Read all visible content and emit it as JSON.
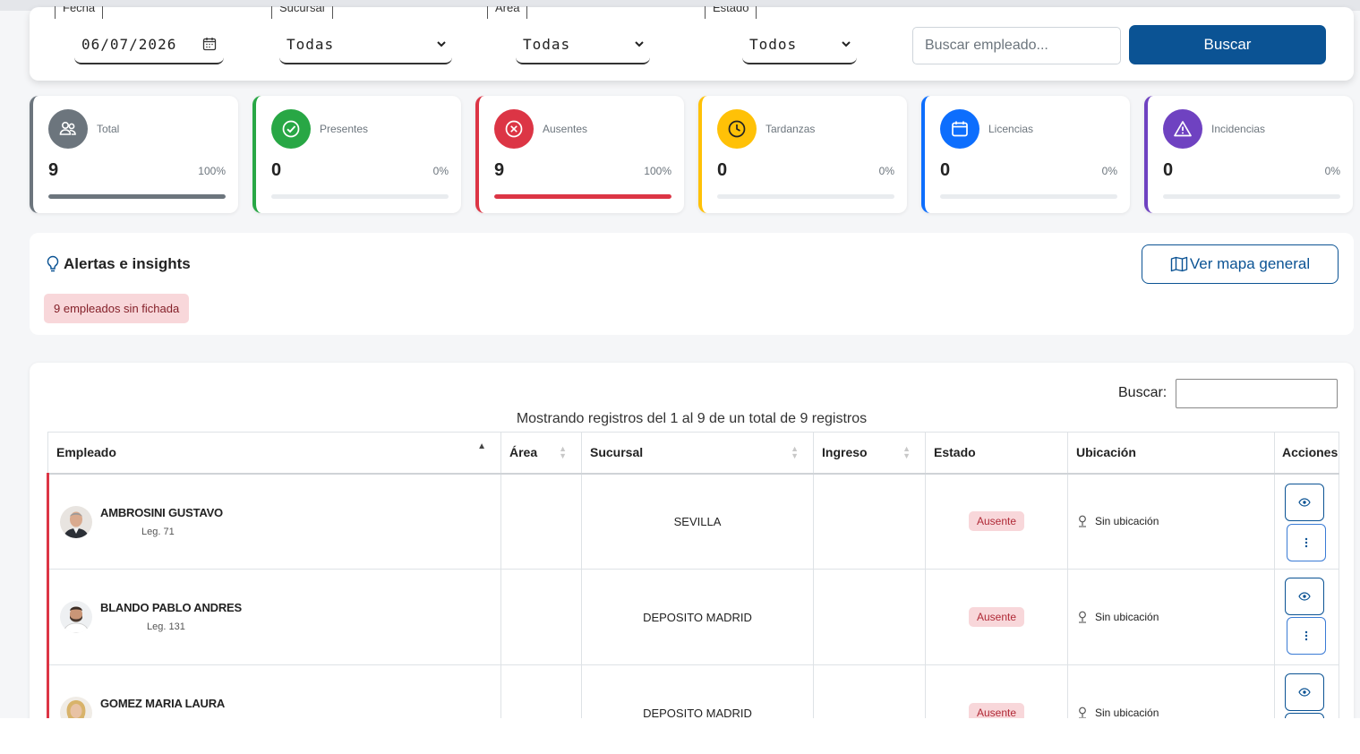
{
  "filters": {
    "fecha_label": "Fecha",
    "fecha_value": "06/07/2026",
    "sucursal_label": "Sucursal",
    "sucursal_value": "Todas",
    "area_label": "Área",
    "area_value": "Todas",
    "estado_label": "Estado",
    "estado_value": "Todos",
    "search_placeholder": "Buscar empleado...",
    "search_button": "Buscar"
  },
  "stats": [
    {
      "label": "Total",
      "value": "9",
      "pct": "100%",
      "fill": 1.0,
      "color": "#6c757d",
      "icon": "people-icon"
    },
    {
      "label": "Presentes",
      "value": "0",
      "pct": "0%",
      "fill": 0.0,
      "color": "#28a745",
      "icon": "check-circle-icon"
    },
    {
      "label": "Ausentes",
      "value": "9",
      "pct": "100%",
      "fill": 1.0,
      "color": "#dc3545",
      "icon": "x-circle-icon"
    },
    {
      "label": "Tardanzas",
      "value": "0",
      "pct": "0%",
      "fill": 0.0,
      "color": "#ffc107",
      "icon": "clock-icon"
    },
    {
      "label": "Licencias",
      "value": "0",
      "pct": "0%",
      "fill": 0.0,
      "color": "#0d6efd",
      "icon": "calendar-icon"
    },
    {
      "label": "Incidencias",
      "value": "0",
      "pct": "0%",
      "fill": 0.0,
      "color": "#6f42c1",
      "icon": "warning-icon"
    }
  ],
  "alerts": {
    "title": "Alertas e insights",
    "badge": "9 empleados sin fichada",
    "map_button": "Ver mapa general"
  },
  "table": {
    "search_label": "Buscar:",
    "info": "Mostrando registros del 1 al 9 de un total de 9 registros",
    "columns": [
      "Empleado",
      "Área",
      "Sucursal",
      "Ingreso",
      "Estado",
      "Ubicación",
      "Acciones"
    ],
    "rows": [
      {
        "name": "AMBROSINI GUSTAVO",
        "leg": "Leg. 71",
        "area": "",
        "sucursal": "SEVILLA",
        "ingreso": "",
        "estado": "Ausente",
        "ubicacion": "Sin ubicación"
      },
      {
        "name": "BLANDO PABLO ANDRES",
        "leg": "Leg. 131",
        "area": "",
        "sucursal": "DEPOSITO MADRID",
        "ingreso": "",
        "estado": "Ausente",
        "ubicacion": "Sin ubicación"
      },
      {
        "name": "GOMEZ MARIA LAURA",
        "leg": "",
        "area": "",
        "sucursal": "DEPOSITO MADRID",
        "ingreso": "",
        "estado": "Ausente",
        "ubicacion": "Sin ubicación"
      }
    ]
  },
  "colors": {
    "primary": "#0b5394",
    "danger": "#dc3545",
    "badge_bg": "#f8d7da"
  }
}
